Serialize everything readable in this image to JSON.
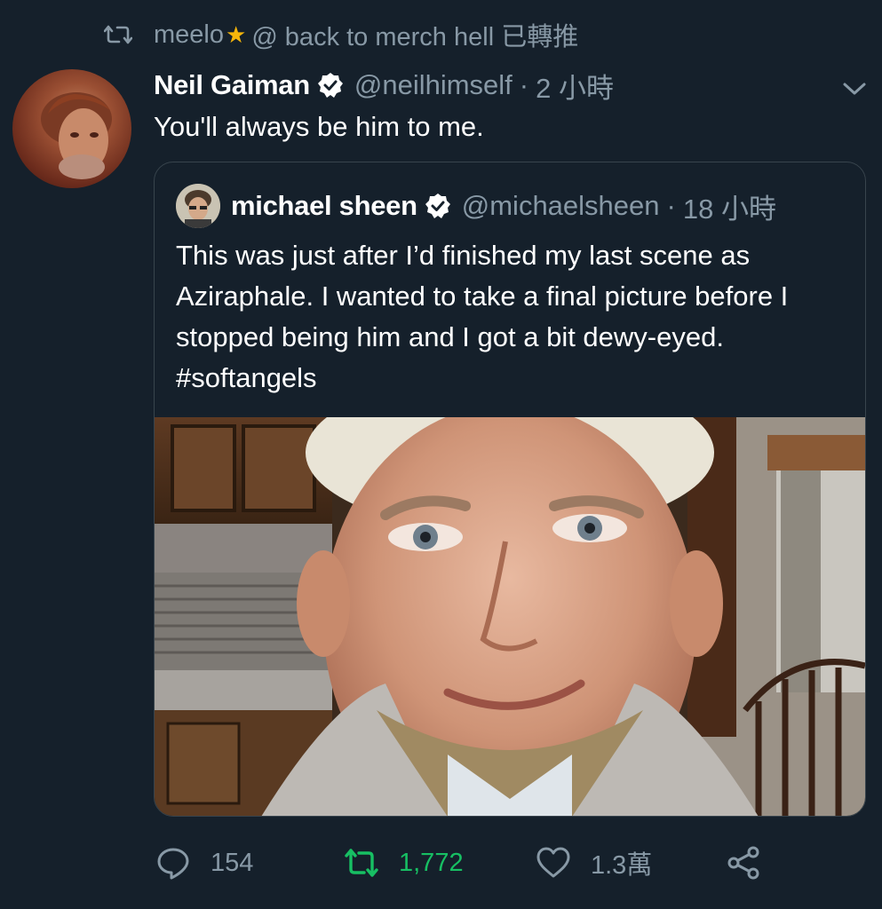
{
  "retweet_bar": {
    "icon": "retweet-icon",
    "user": "meelo",
    "emoji": "★",
    "suffix": "@ back to merch hell 已轉推"
  },
  "tweet": {
    "author_name": "Neil Gaiman",
    "verified_icon": "verified-badge-icon",
    "handle": "@neilhimself",
    "separator": "·",
    "time": "2 小時",
    "text": "You'll always be him to me."
  },
  "quoted_tweet": {
    "author_name": "michael sheen",
    "handle": "@michaelsheen",
    "separator": "·",
    "time": "18 小時",
    "text": "This was just after I’d finished my last scene as Aziraphale. I wanted to take a final picture before I stopped being him and I got a bit dewy-eyed. #softangels"
  },
  "actions": {
    "reply_count": "154",
    "retweet_count": "1,772",
    "like_count": "1.3萬"
  },
  "colors": {
    "background": "#15202b",
    "secondary_text": "#8899a6",
    "retweet_active": "#17bf63",
    "border": "#38444d",
    "star": "#f5b50a"
  }
}
